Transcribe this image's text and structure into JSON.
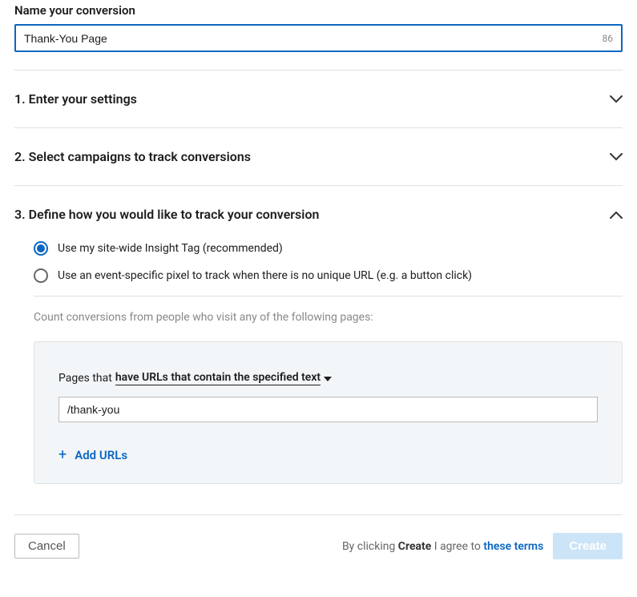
{
  "name_field": {
    "label": "Name your conversion",
    "value": "Thank-You Page",
    "char_count": "86"
  },
  "sections": {
    "s1": {
      "title": "1. Enter your settings"
    },
    "s2": {
      "title": "2. Select campaigns to track conversions"
    },
    "s3": {
      "title": "3. Define how you would like to track your conversion"
    }
  },
  "tracking": {
    "radio1_label": "Use my site-wide Insight Tag (recommended)",
    "radio2_label": "Use an event-specific pixel to track when there is no unique URL (e.g. a button click)",
    "helper": "Count conversions from people who visit any of the following pages:",
    "pages_prefix": "Pages that",
    "condition": " have URLs that contain the specified text ",
    "url_value": "/thank-you",
    "add_label": "Add URLs"
  },
  "footer": {
    "cancel": "Cancel",
    "disclaimer_prefix": "By clicking ",
    "disclaimer_bold": "Create",
    "disclaimer_mid": " I agree to ",
    "disclaimer_link": "these terms",
    "create": "Create"
  }
}
